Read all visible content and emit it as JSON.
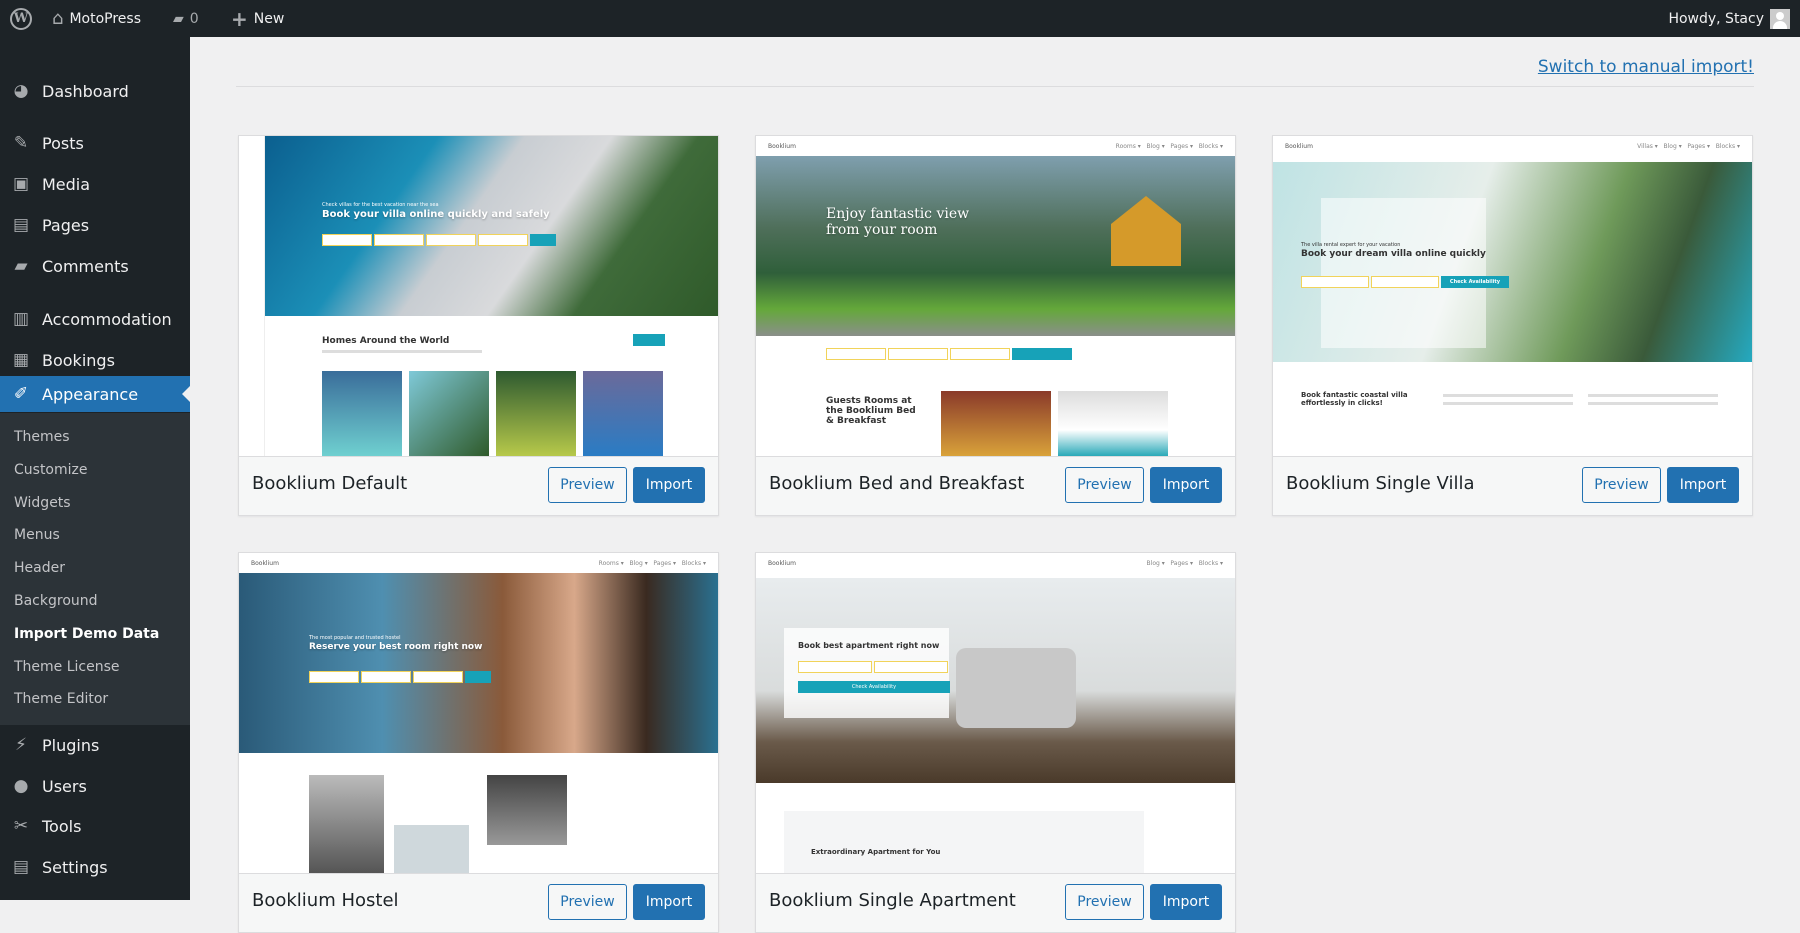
{
  "adminbar": {
    "site": "MotoPress",
    "comments": "0",
    "new": "New",
    "greeting": "Howdy, Stacy"
  },
  "sidebar": {
    "items": [
      {
        "label": "Dashboard",
        "icon": "dashboard-icon"
      },
      {
        "label": "Posts",
        "icon": "pin-icon"
      },
      {
        "label": "Media",
        "icon": "media-icon"
      },
      {
        "label": "Pages",
        "icon": "pages-icon"
      },
      {
        "label": "Comments",
        "icon": "comment-icon"
      },
      {
        "label": "Accommodation",
        "icon": "building-icon"
      },
      {
        "label": "Bookings",
        "icon": "calendar-icon"
      },
      {
        "label": "Appearance",
        "icon": "paintbrush-icon"
      },
      {
        "label": "Plugins",
        "icon": "plug-icon"
      },
      {
        "label": "Users",
        "icon": "user-icon"
      },
      {
        "label": "Tools",
        "icon": "wrench-icon"
      },
      {
        "label": "Settings",
        "icon": "settings-icon"
      }
    ],
    "submenu": [
      "Themes",
      "Customize",
      "Widgets",
      "Menus",
      "Header",
      "Background",
      "Import Demo Data",
      "Theme License",
      "Theme Editor"
    ],
    "active": "Appearance",
    "current_sub": "Import Demo Data"
  },
  "main": {
    "switch_link": "Switch to manual import!",
    "preview_label": "Preview",
    "import_label": "Import",
    "demos": [
      {
        "title": "Booklium Default",
        "headline": "Book your villa online quickly and safely",
        "tagline": "Check villas for the best vacation near the sea",
        "section": "Homes Around the World"
      },
      {
        "title": "Booklium Bed and Breakfast",
        "headline": "Enjoy fantastic view from your room",
        "brand": "Booklium",
        "section": "Guests Rooms at the Booklium Bed & Breakfast"
      },
      {
        "title": "Booklium Single Villa",
        "headline": "Book your dream villa online quickly",
        "tagline": "The villa rental expert for your vacation",
        "brand": "Booklium",
        "section": "Book fantastic coastal villa effortlessly in clicks!",
        "cta": "Check Availability"
      },
      {
        "title": "Booklium Hostel",
        "headline": "Reserve your best room right now",
        "tagline": "The most popular and trusted hostel",
        "brand": "Booklium"
      },
      {
        "title": "Booklium Single Apartment",
        "headline": "Book best apartment right now",
        "brand": "Booklium",
        "section": "Extraordinary Apartment for You",
        "cta": "Check Availability"
      }
    ]
  },
  "colors": {
    "adminbar": "#1d2327",
    "accent": "#2271b1",
    "submenu": "#2c3338",
    "teal": "#17a2b8"
  }
}
